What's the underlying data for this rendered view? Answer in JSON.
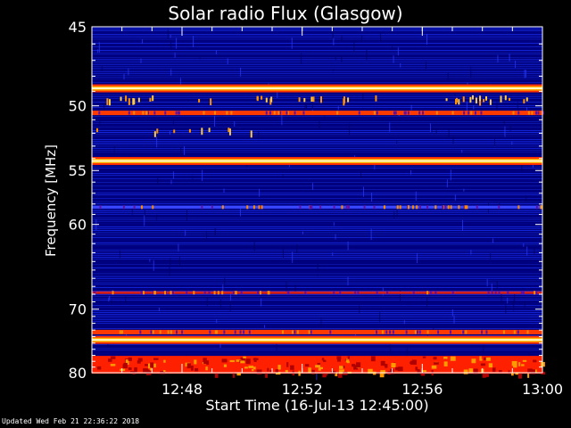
{
  "chart_data": {
    "type": "heatmap",
    "title": "Solar radio Flux (Glasgow)",
    "xlabel": "Start Time (16-Jul-13 12:45:00)",
    "ylabel": "Frequency [MHz]",
    "x_unit": "time (HH:MM)",
    "xlim": [
      "12:45",
      "13:00"
    ],
    "x_ticks": [
      "12:48",
      "12:52",
      "12:56",
      "13:00"
    ],
    "ylim": [
      45,
      80
    ],
    "y_axis_direction": "increasing downward",
    "y_scale": "reciprocal",
    "y_ticks": [
      45,
      50,
      55,
      60,
      70,
      80
    ],
    "y_tick_labels": [
      "45",
      "50",
      "55",
      "60",
      "70",
      "80"
    ],
    "colormap": [
      "#00007a",
      "#0a20d8",
      "#d81010",
      "#ff9a00",
      "#ffffc8"
    ],
    "background_level": "dark blue",
    "steady_bands": [
      {
        "freq_mhz": 48.8,
        "level": "very high",
        "color": "#ffffc8"
      },
      {
        "freq_mhz": 50.5,
        "level": "high",
        "color": "#ff3a00"
      },
      {
        "freq_mhz": 54.2,
        "level": "very high",
        "color": "#ffffc8"
      },
      {
        "freq_mhz": 58.3,
        "level": "moderate",
        "color": "#3a48ff"
      },
      {
        "freq_mhz": 67.8,
        "level": "moderate-high",
        "color": "#d02020"
      },
      {
        "freq_mhz": 73.3,
        "level": "high",
        "color": "#ff3a00"
      },
      {
        "freq_mhz": 74.5,
        "level": "very high",
        "color": "#ffffc8"
      },
      {
        "freq_mhz": 78.6,
        "level": "high",
        "color": "#ff2000"
      }
    ],
    "intermittent_spots_freq_mhz": [
      49.5,
      51.8
    ],
    "footer": "Updated Wed Feb 21 22:36:22 2018"
  },
  "colors": {
    "background": "#000000",
    "axis": "#ffffff",
    "text": "#ffffff"
  }
}
